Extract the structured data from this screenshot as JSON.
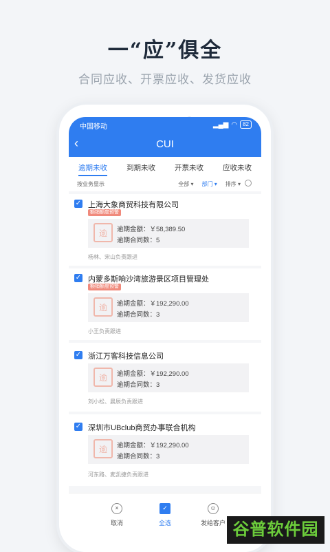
{
  "headline": "一“应”俱全",
  "subline": "合同应收、开票应收、发货应收",
  "status": {
    "carrier": "中国移动",
    "battery": "82"
  },
  "nav": {
    "back": "‹",
    "title": "CUI"
  },
  "tabs": [
    "逾期未收",
    "到期未收",
    "开票未收",
    "应收未收"
  ],
  "filter": {
    "left": "按业务显示",
    "all": "全部 ▾",
    "dept": "部门 ▾",
    "sort": "排序 ▾"
  },
  "cards": [
    {
      "name": "上海大象商贸科技有限公司",
      "tag": "额销额度预警",
      "amount_label": "逾期金额：",
      "amount": "￥58,389.50",
      "count_label": "逾期合同数：",
      "count": "5",
      "footer": "杨林、宋山负责跟进"
    },
    {
      "name": "内蒙多斯响沙湾旅游景区项目管理处",
      "tag": "额销额度预警",
      "amount_label": "逾期金额：",
      "amount": "￥192,290.00",
      "count_label": "逾期合同数：",
      "count": "3",
      "footer": "小王负责跟进"
    },
    {
      "name": "浙江万客科技信息公司",
      "tag": "",
      "amount_label": "逾期金额：",
      "amount": "￥192,290.00",
      "count_label": "逾期合同数：",
      "count": "3",
      "footer": "刘小松、晨辰负责跟进"
    },
    {
      "name": "深圳市UBclub商贸办事联合机构",
      "tag": "",
      "amount_label": "逾期金额：",
      "amount": "￥192,290.00",
      "count_label": "逾期合同数：",
      "count": "3",
      "footer": "河东路、麦凯捷负责跟进"
    }
  ],
  "bottom": {
    "cancel": "取消",
    "select_all": "全选",
    "send": "发给客户"
  },
  "badge": "谷普软件园"
}
